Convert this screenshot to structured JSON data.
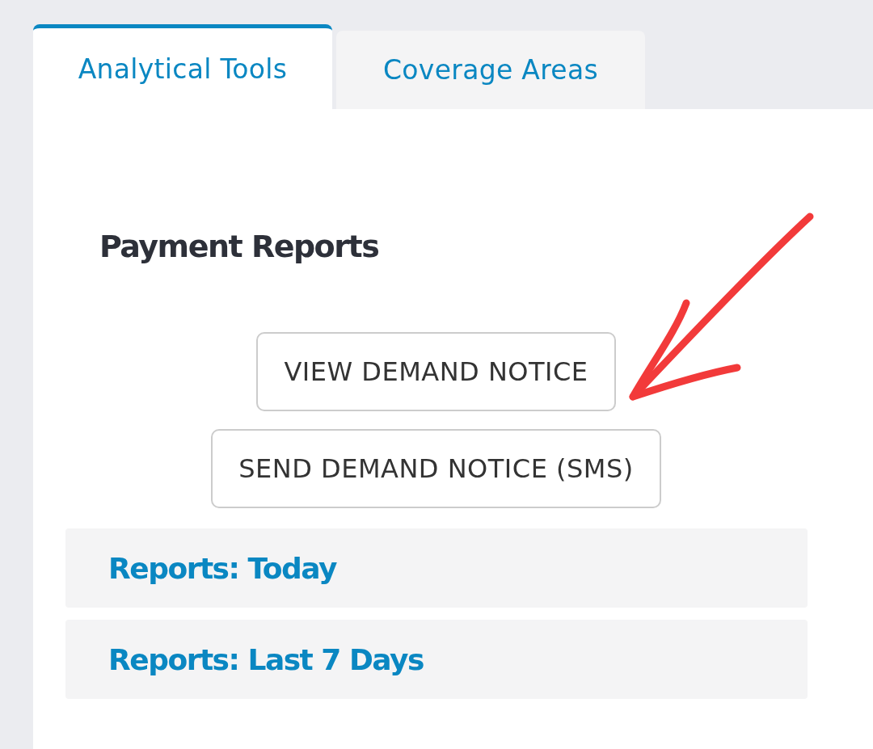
{
  "tabs": [
    {
      "label": "Analytical Tools",
      "selected": true
    },
    {
      "label": "Coverage Areas",
      "selected": false
    }
  ],
  "section": {
    "title": "Payment Reports"
  },
  "buttons": [
    "VIEW DEMAND NOTICE",
    "SEND DEMAND NOTICE (SMS)"
  ],
  "accordion": [
    {
      "title": "Reports: Today"
    },
    {
      "title": "Reports: Last 7 Days"
    }
  ]
}
